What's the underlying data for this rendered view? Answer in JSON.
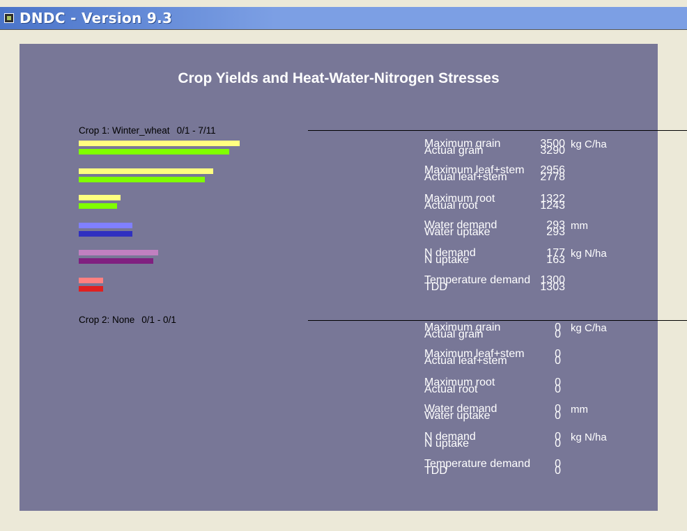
{
  "window": {
    "title": "DNDC - Version 9.3"
  },
  "panel": {
    "title": "Crop Yields and Heat-Water-Nitrogen Stresses"
  },
  "colors": {
    "panel_bg": "#787797",
    "grain_max": "#ffff80",
    "grain_act": "#80ff00",
    "water_max": "#8080ff",
    "water_act": "#3030c0",
    "n_max": "#c080c0",
    "n_act": "#802080",
    "temp_max": "#ff8080",
    "temp_act": "#e02020"
  },
  "crops": [
    {
      "label": "Crop 1: Winter_wheat",
      "range": "0/1 - 7/11",
      "bar_fractions": [
        [
          0.93,
          0.87
        ],
        [
          0.78,
          0.73
        ],
        [
          0.24,
          0.22
        ],
        [
          0.31,
          0.31
        ],
        [
          0.46,
          0.43
        ],
        [
          0.14,
          0.14
        ]
      ],
      "rows": [
        {
          "label1": "Maximum grain",
          "label2": "Actual grain",
          "value1": "3500",
          "value2": "3290",
          "unit": "kg C/ha"
        },
        {
          "label1": "Maximum leaf+stem",
          "label2": "Actual leaf+stem",
          "value1": "2956",
          "value2": "2778",
          "unit": ""
        },
        {
          "label1": "Maximum root",
          "label2": "Actual root",
          "value1": "1322",
          "value2": "1243",
          "unit": ""
        },
        {
          "label1": "Water demand",
          "label2": "Water uptake",
          "value1": "293",
          "value2": "293",
          "unit": "mm"
        },
        {
          "label1": "N demand",
          "label2": "N uptake",
          "value1": "177",
          "value2": "163",
          "unit": "kg N/ha"
        },
        {
          "label1": "Temperature demand",
          "label2": "TDD",
          "value1": "1300",
          "value2": "1303",
          "unit": ""
        }
      ]
    },
    {
      "label": "Crop 2: None",
      "range": "0/1 - 0/1",
      "rows": [
        {
          "label1": "Maximum grain",
          "label2": "Actual grain",
          "value1": "0",
          "value2": "0",
          "unit": "kg C/ha"
        },
        {
          "label1": "Maximum leaf+stem",
          "label2": "Actual leaf+stem",
          "value1": "0",
          "value2": "0",
          "unit": ""
        },
        {
          "label1": "Maximum root",
          "label2": "Actual root",
          "value1": "0",
          "value2": "0",
          "unit": ""
        },
        {
          "label1": "Water demand",
          "label2": "Water uptake",
          "value1": "0",
          "value2": "0",
          "unit": "mm"
        },
        {
          "label1": "N demand",
          "label2": "N uptake",
          "value1": "0",
          "value2": "0",
          "unit": "kg N/ha"
        },
        {
          "label1": "Temperature demand",
          "label2": "TDD",
          "value1": "0",
          "value2": "0",
          "unit": ""
        }
      ]
    }
  ]
}
